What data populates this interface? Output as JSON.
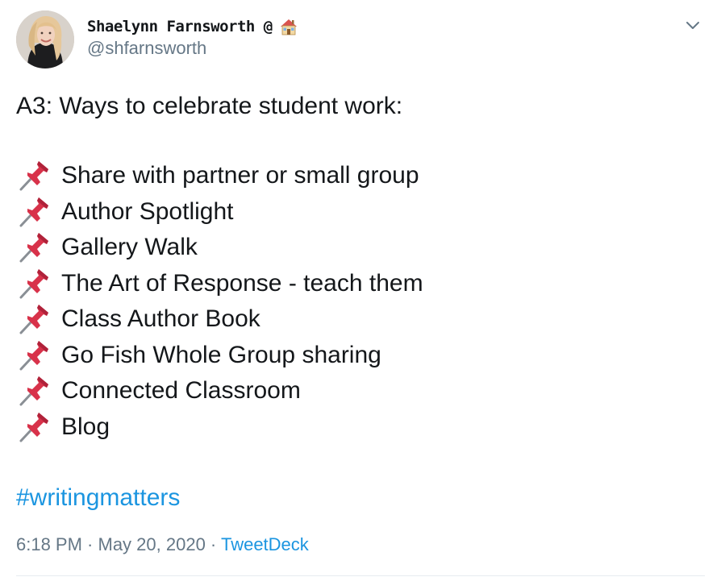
{
  "author": {
    "display_name": "Shaelynn Farnsworth @",
    "handle": "@shfarnsworth",
    "name_emoji": "house-icon"
  },
  "tweet": {
    "headline": "A3: Ways to celebrate student work:",
    "items": [
      "Share with partner or small group",
      "Author Spotlight",
      "Gallery Walk",
      "The Art of Response - teach them",
      "Class Author Book",
      "Go Fish Whole Group sharing",
      "Connected Classroom",
      "Blog"
    ],
    "item_icon": "pushpin-icon",
    "hashtag": "#writingmatters"
  },
  "meta": {
    "time": "6:18 PM",
    "separator1": " · ",
    "date": "May 20, 2020",
    "separator2": " · ",
    "source": "TweetDeck"
  },
  "colors": {
    "link": "#1b95e0",
    "secondary": "#657786",
    "text": "#14171a",
    "divider": "#e6ecf0"
  }
}
